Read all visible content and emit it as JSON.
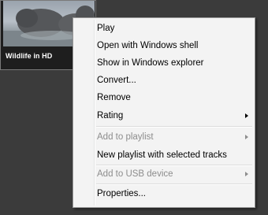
{
  "tile": {
    "title": "Wildlife in HD"
  },
  "menu": {
    "items": [
      {
        "label": "Play",
        "enabled": true,
        "submenu": false
      },
      {
        "label": "Open with Windows shell",
        "enabled": true,
        "submenu": false
      },
      {
        "label": "Show in Windows explorer",
        "enabled": true,
        "submenu": false
      },
      {
        "label": "Convert...",
        "enabled": true,
        "submenu": false
      },
      {
        "label": "Remove",
        "enabled": true,
        "submenu": false
      },
      {
        "label": "Rating",
        "enabled": true,
        "submenu": true
      },
      {
        "label": "Add to playlist",
        "enabled": false,
        "submenu": true
      },
      {
        "label": "New playlist with selected tracks",
        "enabled": true,
        "submenu": false
      },
      {
        "label": "Add to USB device",
        "enabled": false,
        "submenu": true
      },
      {
        "label": "Properties...",
        "enabled": true,
        "submenu": false
      }
    ]
  }
}
